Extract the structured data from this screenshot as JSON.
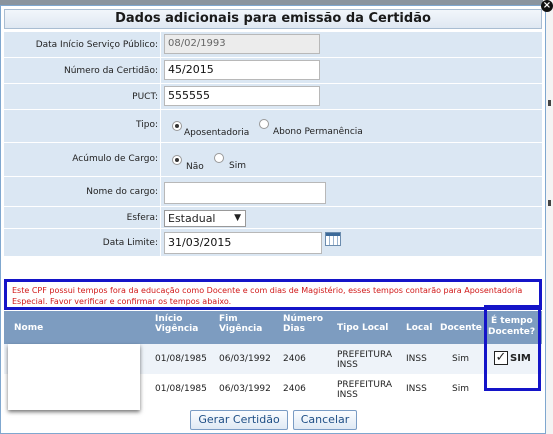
{
  "dialog": {
    "title": "Dados adicionais para emissão da Certidão",
    "close_glyph": "×"
  },
  "form": {
    "data_inicio_label": "Data Início Serviço Público:",
    "data_inicio_value": "08/02/1993",
    "numero_label": "Número da Certidão:",
    "numero_value": "45/2015",
    "puct_label": "PUCT:",
    "puct_value": "555555",
    "tipo_label": "Tipo:",
    "tipo_options": [
      "Aposentadoria",
      "Abono Permanência"
    ],
    "tipo_selected": "Aposentadoria",
    "acumulo_label": "Acúmulo de Cargo:",
    "acumulo_options": [
      "Não",
      "Sim"
    ],
    "acumulo_selected": "Não",
    "nome_cargo_label": "Nome do cargo:",
    "nome_cargo_value": "",
    "esfera_label": "Esfera:",
    "esfera_value": "Estadual",
    "data_limite_label": "Data Limite:",
    "data_limite_value": "31/03/2015"
  },
  "warning": {
    "text": "Este CPF possui tempos fora da educação como Docente e com dias de Magistério, esses tempos contarão para Aposentadoria Especial. Favor verificar e confirmar os tempos abaixo."
  },
  "table": {
    "headers": {
      "nome": "Nome",
      "inicio_1": "Início",
      "inicio_2": "Vigência",
      "fim_1": "Fim",
      "fim_2": "Vigência",
      "numero_1": "Número",
      "numero_2": "Dias",
      "tipo_local": "Tipo Local",
      "local": "Local",
      "docente": "Docente",
      "tempo_1": "É tempo",
      "tempo_2": "Docente?"
    },
    "rows": [
      {
        "inicio": "01/08/1985",
        "fim": "06/03/1992",
        "dias": "2406",
        "tipo_local_1": "PREFEITURA",
        "tipo_local_2": "INSS",
        "local": "INSS",
        "docente": "Sim"
      },
      {
        "inicio": "01/08/1985",
        "fim": "06/03/1992",
        "dias": "2406",
        "tipo_local_1": "PREFEITURA",
        "tipo_local_2": "INSS",
        "local": "INSS",
        "docente": "Sim"
      }
    ],
    "tempo_docente_check": "✓",
    "tempo_docente_label": "SIM"
  },
  "buttons": {
    "gerar": "Gerar Certidão",
    "cancelar": "Cancelar"
  },
  "colors": {
    "header_bg": "#7d9cc0",
    "form_bg": "#dbe7f3",
    "highlight_border": "#1414c8",
    "warning_text": "#d01818"
  }
}
